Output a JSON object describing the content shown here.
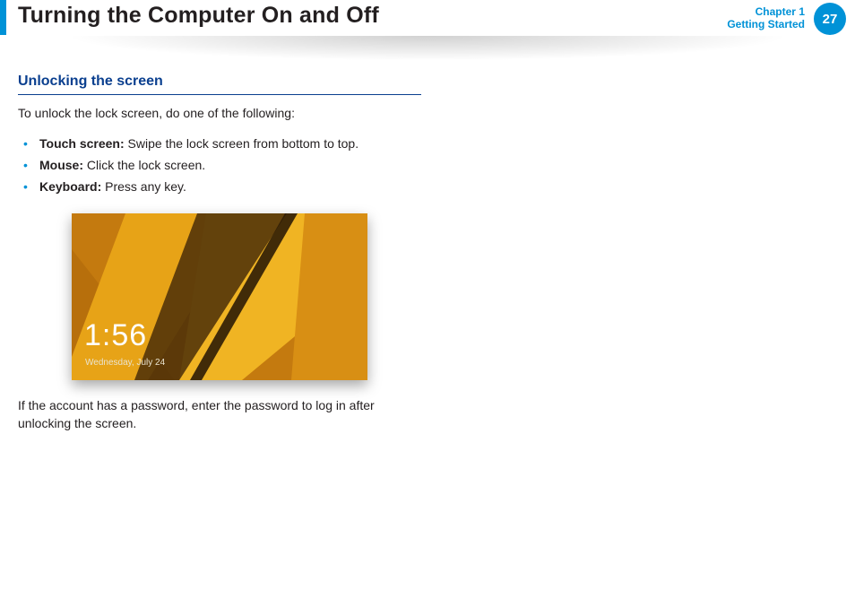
{
  "header": {
    "title": "Turning the Computer On and Off",
    "chapter_line1": "Chapter 1",
    "chapter_line2": "Getting Started",
    "page_number": "27"
  },
  "section": {
    "heading": "Unlocking the screen",
    "intro": "To unlock the lock screen, do one of the following:",
    "bullets": [
      {
        "label": "Touch screen:",
        "text": " Swipe the lock screen from bottom to top."
      },
      {
        "label": "Mouse:",
        "text": " Click the lock screen."
      },
      {
        "label": "Keyboard:",
        "text": " Press any key."
      }
    ],
    "after": "If the account has a password, enter the password to log in after unlocking the screen."
  },
  "lockscreen": {
    "time": "1:56",
    "date": "Wednesday, July 24"
  }
}
